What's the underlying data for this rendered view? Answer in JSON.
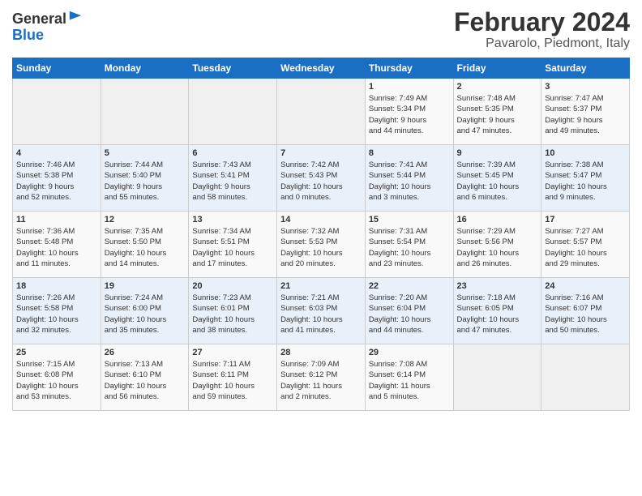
{
  "header": {
    "logo_general": "General",
    "logo_blue": "Blue",
    "main_title": "February 2024",
    "subtitle": "Pavarolo, Piedmont, Italy"
  },
  "days_of_week": [
    "Sunday",
    "Monday",
    "Tuesday",
    "Wednesday",
    "Thursday",
    "Friday",
    "Saturday"
  ],
  "weeks": [
    [
      {
        "num": "",
        "info": ""
      },
      {
        "num": "",
        "info": ""
      },
      {
        "num": "",
        "info": ""
      },
      {
        "num": "",
        "info": ""
      },
      {
        "num": "1",
        "info": "Sunrise: 7:49 AM\nSunset: 5:34 PM\nDaylight: 9 hours\nand 44 minutes."
      },
      {
        "num": "2",
        "info": "Sunrise: 7:48 AM\nSunset: 5:35 PM\nDaylight: 9 hours\nand 47 minutes."
      },
      {
        "num": "3",
        "info": "Sunrise: 7:47 AM\nSunset: 5:37 PM\nDaylight: 9 hours\nand 49 minutes."
      }
    ],
    [
      {
        "num": "4",
        "info": "Sunrise: 7:46 AM\nSunset: 5:38 PM\nDaylight: 9 hours\nand 52 minutes."
      },
      {
        "num": "5",
        "info": "Sunrise: 7:44 AM\nSunset: 5:40 PM\nDaylight: 9 hours\nand 55 minutes."
      },
      {
        "num": "6",
        "info": "Sunrise: 7:43 AM\nSunset: 5:41 PM\nDaylight: 9 hours\nand 58 minutes."
      },
      {
        "num": "7",
        "info": "Sunrise: 7:42 AM\nSunset: 5:43 PM\nDaylight: 10 hours\nand 0 minutes."
      },
      {
        "num": "8",
        "info": "Sunrise: 7:41 AM\nSunset: 5:44 PM\nDaylight: 10 hours\nand 3 minutes."
      },
      {
        "num": "9",
        "info": "Sunrise: 7:39 AM\nSunset: 5:45 PM\nDaylight: 10 hours\nand 6 minutes."
      },
      {
        "num": "10",
        "info": "Sunrise: 7:38 AM\nSunset: 5:47 PM\nDaylight: 10 hours\nand 9 minutes."
      }
    ],
    [
      {
        "num": "11",
        "info": "Sunrise: 7:36 AM\nSunset: 5:48 PM\nDaylight: 10 hours\nand 11 minutes."
      },
      {
        "num": "12",
        "info": "Sunrise: 7:35 AM\nSunset: 5:50 PM\nDaylight: 10 hours\nand 14 minutes."
      },
      {
        "num": "13",
        "info": "Sunrise: 7:34 AM\nSunset: 5:51 PM\nDaylight: 10 hours\nand 17 minutes."
      },
      {
        "num": "14",
        "info": "Sunrise: 7:32 AM\nSunset: 5:53 PM\nDaylight: 10 hours\nand 20 minutes."
      },
      {
        "num": "15",
        "info": "Sunrise: 7:31 AM\nSunset: 5:54 PM\nDaylight: 10 hours\nand 23 minutes."
      },
      {
        "num": "16",
        "info": "Sunrise: 7:29 AM\nSunset: 5:56 PM\nDaylight: 10 hours\nand 26 minutes."
      },
      {
        "num": "17",
        "info": "Sunrise: 7:27 AM\nSunset: 5:57 PM\nDaylight: 10 hours\nand 29 minutes."
      }
    ],
    [
      {
        "num": "18",
        "info": "Sunrise: 7:26 AM\nSunset: 5:58 PM\nDaylight: 10 hours\nand 32 minutes."
      },
      {
        "num": "19",
        "info": "Sunrise: 7:24 AM\nSunset: 6:00 PM\nDaylight: 10 hours\nand 35 minutes."
      },
      {
        "num": "20",
        "info": "Sunrise: 7:23 AM\nSunset: 6:01 PM\nDaylight: 10 hours\nand 38 minutes."
      },
      {
        "num": "21",
        "info": "Sunrise: 7:21 AM\nSunset: 6:03 PM\nDaylight: 10 hours\nand 41 minutes."
      },
      {
        "num": "22",
        "info": "Sunrise: 7:20 AM\nSunset: 6:04 PM\nDaylight: 10 hours\nand 44 minutes."
      },
      {
        "num": "23",
        "info": "Sunrise: 7:18 AM\nSunset: 6:05 PM\nDaylight: 10 hours\nand 47 minutes."
      },
      {
        "num": "24",
        "info": "Sunrise: 7:16 AM\nSunset: 6:07 PM\nDaylight: 10 hours\nand 50 minutes."
      }
    ],
    [
      {
        "num": "25",
        "info": "Sunrise: 7:15 AM\nSunset: 6:08 PM\nDaylight: 10 hours\nand 53 minutes."
      },
      {
        "num": "26",
        "info": "Sunrise: 7:13 AM\nSunset: 6:10 PM\nDaylight: 10 hours\nand 56 minutes."
      },
      {
        "num": "27",
        "info": "Sunrise: 7:11 AM\nSunset: 6:11 PM\nDaylight: 10 hours\nand 59 minutes."
      },
      {
        "num": "28",
        "info": "Sunrise: 7:09 AM\nSunset: 6:12 PM\nDaylight: 11 hours\nand 2 minutes."
      },
      {
        "num": "29",
        "info": "Sunrise: 7:08 AM\nSunset: 6:14 PM\nDaylight: 11 hours\nand 5 minutes."
      },
      {
        "num": "",
        "info": ""
      },
      {
        "num": "",
        "info": ""
      }
    ]
  ]
}
